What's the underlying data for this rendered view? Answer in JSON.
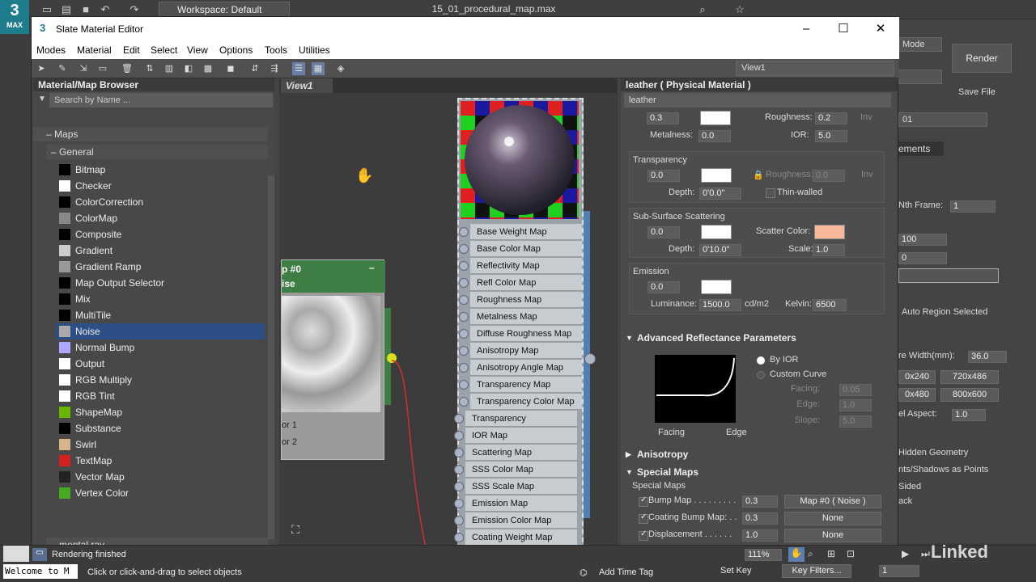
{
  "app": {
    "logo_text": "3",
    "logo_sub": "MAX",
    "workspace": "Workspace: Default",
    "file_title": "15_01_procedural_map.max"
  },
  "window": {
    "title": "Slate Material Editor"
  },
  "menu": [
    "Modes",
    "Material",
    "Edit",
    "Select",
    "View",
    "Options",
    "Tools",
    "Utilities"
  ],
  "view_selector": "View1",
  "browser": {
    "title": "Material/Map Browser",
    "search_placeholder": "Search by Name ...",
    "section_maps": "Maps",
    "section_general": "General",
    "section_mentalray": "mental ray",
    "items": [
      {
        "label": "Bitmap",
        "color": "#000000"
      },
      {
        "label": "Checker",
        "color": "#ffffff"
      },
      {
        "label": "ColorCorrection",
        "color": "#000000"
      },
      {
        "label": "ColorMap",
        "color": "#888888"
      },
      {
        "label": "Composite",
        "color": "#000000"
      },
      {
        "label": "Gradient",
        "color": "#cccccc"
      },
      {
        "label": "Gradient Ramp",
        "color": "#999999"
      },
      {
        "label": "Map Output Selector",
        "color": "#000000"
      },
      {
        "label": "Mix",
        "color": "#000000"
      },
      {
        "label": "MultiTile",
        "color": "#000000"
      },
      {
        "label": "Noise",
        "color": "#aaaaaa"
      },
      {
        "label": "Normal Bump",
        "color": "#b0a8ff"
      },
      {
        "label": "Output",
        "color": "#ffffff"
      },
      {
        "label": "RGB Multiply",
        "color": "#ffffff"
      },
      {
        "label": "RGB Tint",
        "color": "#ffffff"
      },
      {
        "label": "ShapeMap",
        "color": "#6ab500"
      },
      {
        "label": "Substance",
        "color": "#000000"
      },
      {
        "label": "Swirl",
        "color": "#d8b48a"
      },
      {
        "label": "TextMap",
        "color": "#d42020"
      },
      {
        "label": "Vector Map",
        "color": "#222222"
      },
      {
        "label": "Vertex Color",
        "color": "#44aa22"
      }
    ]
  },
  "view": {
    "tab": "View1"
  },
  "noise_node": {
    "title1": "p #0",
    "title2": "ise",
    "row1": "or 1",
    "row2": "or 2"
  },
  "material_slots": [
    "Base Weight Map",
    "Base Color Map",
    "Reflectivity Map",
    "Refl Color Map",
    "Roughness Map",
    "Metalness Map",
    "Diffuse Roughness Map",
    "Anisotropy Map",
    "Anisotropy Angle Map",
    "Transparency Map",
    "Transparency Color Map",
    "Transparency Roughness...",
    "IOR Map",
    "Scattering Map",
    "SSS Color Map",
    "SSS Scale Map",
    "Emission Map",
    "Emission Color Map",
    "Coating Weight Map"
  ],
  "params": {
    "title": "leather  ( Physical Material )",
    "name": "leather",
    "top": {
      "val": "0.3",
      "roughness_label": "Roughness:",
      "roughness": "0.2",
      "inv": "Inv",
      "metalness_label": "Metalness:",
      "metalness": "0.0",
      "ior_label": "IOR:",
      "ior": "5.0"
    },
    "transparency": {
      "label": "Transparency",
      "val": "0.0",
      "roughness_label": "Roughness:",
      "roughness": "0.0",
      "inv": "Inv",
      "depth_label": "Depth:",
      "depth": "0'0.0\"",
      "thin": "Thin-walled"
    },
    "sss": {
      "label": "Sub-Surface Scattering",
      "val": "0.0",
      "scatter_label": "Scatter Color:",
      "scatter_color": "#f7b89a",
      "depth_label": "Depth:",
      "depth": "0'10.0\"",
      "scale_label": "Scale:",
      "scale": "1.0"
    },
    "emission": {
      "label": "Emission",
      "val": "0.0",
      "lum_label": "Luminance:",
      "lum": "1500.0",
      "unit": "cd/m2",
      "kelvin_label": "Kelvin:",
      "kelvin": "6500"
    },
    "adv": {
      "label": "Advanced Reflectance Parameters",
      "by_ior": "By IOR",
      "custom": "Custom Curve",
      "facing_label": "Facing:",
      "facing": "0.05",
      "edge_label": "Edge:",
      "edge": "1.0",
      "slope_label": "Slope:",
      "slope": "5.0",
      "curve_facing": "Facing",
      "curve_edge": "Edge"
    },
    "aniso": "Anisotropy",
    "special": {
      "label": "Special Maps",
      "sublabel": "Special Maps",
      "rows": [
        {
          "label": "Bump Map . . . . . . . . .",
          "val": "0.3",
          "btn": "Map #0  ( Noise )"
        },
        {
          "label": "Coating Bump Map: . .",
          "val": "0.3",
          "btn": "None"
        },
        {
          "label": "Displacement . . . . . .",
          "val": "1.0",
          "btn": "None"
        }
      ]
    }
  },
  "right_panel": {
    "mode": "Mode",
    "render": "Render",
    "save_file": "Save File",
    "id": "01",
    "tab": "ements",
    "nth": "Nth Frame:",
    "nth_val": "1",
    "val100": "100",
    "val0": "0",
    "auto_region": "Auto Region Selected",
    "width_label": "re Width(mm):",
    "width": "36.0",
    "r1": "0x240",
    "r2": "720x486",
    "r3": "0x480",
    "r4": "800x600",
    "aspect_label": "el Aspect:",
    "aspect": "1.0",
    "hidden": "Hidden Geometry",
    "shadows": "nts/Shadows as Points",
    "sided": "Sided",
    "ack": "ack"
  },
  "status": {
    "rendering": "Rendering finished",
    "welcome": "Welcome to M",
    "hint": "Click or click-and-drag to select objects",
    "add_time_tag": "Add Time Tag",
    "set_key": "Set Key",
    "key_filters": "Key Filters...",
    "frame": "1",
    "zoom": "111%",
    "brand": "Linked"
  }
}
